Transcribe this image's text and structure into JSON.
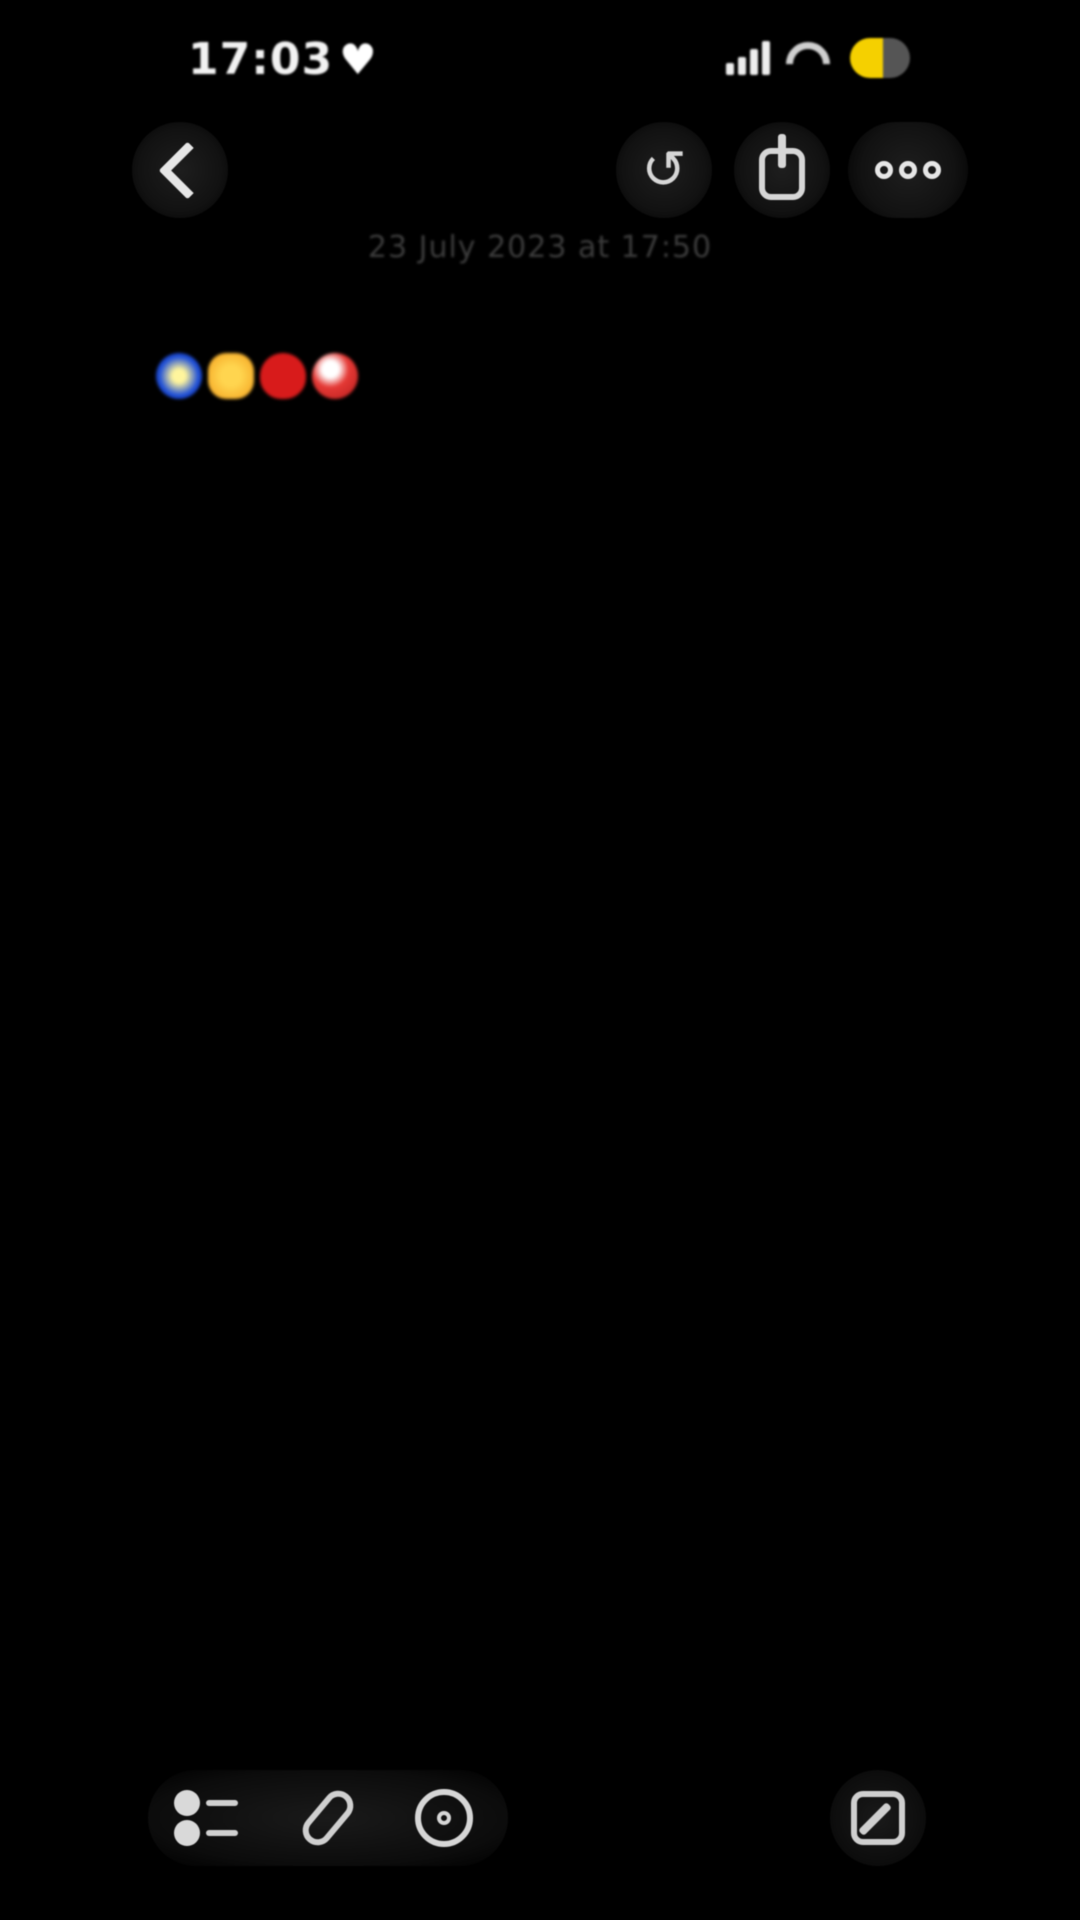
{
  "status_bar": {
    "time": "17:03"
  },
  "note": {
    "date": "23 July 2023 at 17:50",
    "paragraphs": [
      "",
      "",
      "",
      "",
      "",
      "",
      "",
      "",
      "",
      "",
      "",
      "",
      "",
      "",
      "",
      "",
      "",
      "",
      "",
      "",
      "",
      ""
    ]
  },
  "icons": {
    "back": "chevron-left-icon",
    "undo": "undo-icon",
    "share": "share-icon",
    "more": "ellipsis-icon",
    "checklist": "checklist-icon",
    "attach": "paperclip-icon",
    "pen": "pen-icon",
    "compose": "compose-icon"
  },
  "colors": {
    "background": "#000000",
    "battery": "#f5d000"
  }
}
